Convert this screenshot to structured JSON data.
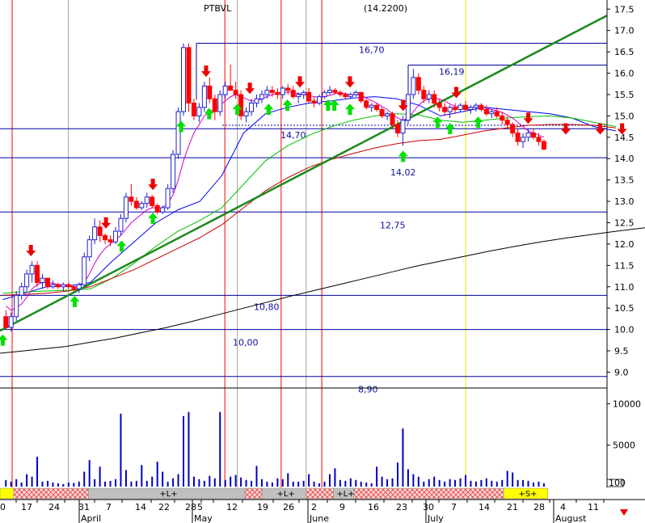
{
  "chart_data": {
    "type": "candlestick",
    "title": "PTBVL",
    "header_values": "(14.2200)",
    "colors": {
      "up": "#2020d0",
      "down": "#ff0000",
      "ma_fast": "#cc00cc",
      "ma_blue": "#0000ff",
      "ma_green": "#00c000",
      "ma_red": "#cc0000",
      "ma_long": "#000000",
      "trendline": "#1a8a1a",
      "level_line": "#0000a0",
      "volume": "#0000c0",
      "buy_arrow": "#00e000",
      "sell_arrow": "#ee0000",
      "vline_red": "#ff0000",
      "vline_gray": "#a0a0a0",
      "vline_yellow": "#e8e800"
    },
    "y_axis": {
      "range": [
        8.8,
        17.6
      ],
      "ticks": [
        "17.5",
        "17.0",
        "16.5",
        "16.0",
        "15.5",
        "15.0",
        "14.5",
        "14.0",
        "13.5",
        "13.0",
        "12.5",
        "12.0",
        "11.5",
        "11.0",
        "10.5",
        "10.0",
        "9.5",
        "9.0"
      ]
    },
    "volume_axis": {
      "range": [
        0,
        11500
      ],
      "ticks": [
        "10000",
        "5000"
      ],
      "footer": "100"
    },
    "x_axis": {
      "day_labels": [
        "0",
        "17",
        "24",
        "31",
        "7",
        "14",
        "22",
        "28",
        "5",
        "12",
        "19",
        "26",
        "2",
        "9",
        "16",
        "23",
        "30",
        "7",
        "14",
        "21",
        "28",
        "4",
        "11"
      ],
      "month_labels": [
        "April",
        "May",
        "June",
        "July",
        "August"
      ]
    },
    "levels": [
      {
        "value": 16.7,
        "label": "16,70"
      },
      {
        "value": 16.19,
        "label": "16,19"
      },
      {
        "value": 14.7,
        "label": "14,70"
      },
      {
        "value": 14.02,
        "label": "14,02"
      },
      {
        "value": 12.75,
        "label": "12,75"
      },
      {
        "value": 10.8,
        "label": "10,80"
      },
      {
        "value": 10.0,
        "label": "10,00"
      },
      {
        "value": 8.9,
        "label": "8,90"
      }
    ],
    "dotted_level": 14.78,
    "trendline": {
      "start": [
        0,
        9.97
      ],
      "end": [
        141,
        17.35
      ]
    },
    "candles": [
      [
        10.3,
        10.45,
        10.0,
        10.05
      ],
      [
        10.05,
        10.4,
        9.95,
        10.3
      ],
      [
        10.3,
        10.9,
        10.2,
        10.8
      ],
      [
        10.8,
        11.1,
        10.7,
        11.0
      ],
      [
        11.0,
        11.4,
        10.9,
        11.3
      ],
      [
        11.3,
        11.6,
        11.1,
        11.5
      ],
      [
        11.5,
        11.6,
        11.0,
        11.1
      ],
      [
        11.1,
        11.3,
        10.95,
        11.2
      ],
      [
        11.2,
        11.2,
        10.95,
        11.0
      ],
      [
        11.0,
        11.15,
        10.95,
        11.05
      ],
      [
        11.05,
        11.1,
        10.95,
        11.0
      ],
      [
        11.0,
        11.1,
        10.9,
        11.05
      ],
      [
        11.05,
        11.1,
        10.95,
        11.0
      ],
      [
        11.0,
        11.05,
        10.9,
        10.95
      ],
      [
        10.95,
        11.1,
        10.85,
        11.05
      ],
      [
        11.05,
        11.8,
        11.0,
        11.7
      ],
      [
        11.7,
        12.2,
        11.6,
        12.1
      ],
      [
        12.1,
        12.6,
        12.0,
        12.4
      ],
      [
        12.4,
        12.55,
        12.05,
        12.2
      ],
      [
        12.2,
        12.25,
        12.0,
        12.1
      ],
      [
        12.1,
        12.2,
        11.95,
        12.05
      ],
      [
        12.05,
        12.4,
        12.0,
        12.3
      ],
      [
        12.3,
        12.7,
        12.2,
        12.6
      ],
      [
        12.6,
        13.2,
        12.5,
        13.1
      ],
      [
        13.1,
        13.4,
        12.9,
        13.0
      ],
      [
        13.0,
        13.1,
        12.8,
        12.85
      ],
      [
        12.85,
        13.0,
        12.8,
        12.95
      ],
      [
        12.95,
        13.2,
        12.85,
        13.1
      ],
      [
        13.1,
        13.15,
        12.85,
        12.9
      ],
      [
        12.9,
        12.95,
        12.7,
        12.75
      ],
      [
        12.75,
        12.9,
        12.7,
        12.85
      ],
      [
        12.85,
        13.4,
        12.8,
        13.3
      ],
      [
        13.3,
        14.2,
        13.2,
        14.1
      ],
      [
        14.1,
        15.2,
        14.0,
        15.1
      ],
      [
        15.1,
        16.7,
        15.0,
        16.6
      ],
      [
        16.6,
        16.7,
        15.1,
        15.3
      ],
      [
        15.3,
        15.4,
        14.9,
        15.0
      ],
      [
        15.0,
        15.3,
        14.85,
        15.2
      ],
      [
        15.2,
        15.8,
        15.1,
        15.7
      ],
      [
        15.7,
        15.9,
        15.3,
        15.4
      ],
      [
        15.4,
        15.5,
        14.9,
        15.1
      ],
      [
        15.1,
        15.6,
        15.0,
        15.5
      ],
      [
        15.5,
        15.8,
        15.4,
        15.7
      ],
      [
        15.7,
        16.2,
        15.6,
        15.6
      ],
      [
        15.6,
        15.8,
        15.4,
        15.5
      ],
      [
        15.5,
        15.6,
        14.9,
        15.0
      ],
      [
        15.0,
        15.2,
        14.85,
        15.1
      ],
      [
        15.1,
        15.4,
        15.0,
        15.3
      ],
      [
        15.3,
        15.5,
        15.2,
        15.4
      ],
      [
        15.4,
        15.6,
        15.3,
        15.5
      ],
      [
        15.5,
        15.7,
        15.4,
        15.6
      ],
      [
        15.6,
        15.7,
        15.45,
        15.55
      ],
      [
        15.55,
        15.65,
        15.4,
        15.5
      ],
      [
        15.5,
        15.7,
        15.4,
        15.65
      ],
      [
        15.65,
        15.75,
        15.5,
        15.6
      ],
      [
        15.6,
        15.7,
        15.4,
        15.45
      ],
      [
        15.45,
        15.55,
        15.3,
        15.5
      ],
      [
        15.5,
        15.6,
        15.4,
        15.55
      ],
      [
        15.55,
        15.65,
        15.3,
        15.35
      ],
      [
        15.35,
        15.45,
        15.2,
        15.3
      ],
      [
        15.3,
        15.5,
        15.25,
        15.45
      ],
      [
        15.45,
        15.6,
        15.4,
        15.55
      ],
      [
        15.55,
        15.7,
        15.5,
        15.6
      ],
      [
        15.6,
        15.65,
        15.5,
        15.55
      ],
      [
        15.55,
        15.6,
        15.45,
        15.5
      ],
      [
        15.5,
        15.55,
        15.4,
        15.45
      ],
      [
        15.45,
        15.55,
        15.4,
        15.5
      ],
      [
        15.5,
        15.6,
        15.45,
        15.55
      ],
      [
        15.55,
        15.55,
        15.3,
        15.35
      ],
      [
        15.35,
        15.4,
        15.15,
        15.2
      ],
      [
        15.2,
        15.3,
        15.1,
        15.25
      ],
      [
        15.25,
        15.3,
        15.1,
        15.15
      ],
      [
        15.15,
        15.2,
        14.95,
        15.0
      ],
      [
        15.0,
        15.1,
        14.9,
        15.05
      ],
      [
        15.05,
        15.1,
        14.7,
        14.8
      ],
      [
        14.8,
        14.9,
        14.5,
        14.6
      ],
      [
        14.6,
        15.0,
        14.3,
        14.9
      ],
      [
        14.9,
        15.6,
        14.8,
        15.5
      ],
      [
        15.5,
        16.1,
        15.4,
        15.9
      ],
      [
        15.9,
        16.0,
        15.5,
        15.6
      ],
      [
        15.6,
        15.7,
        15.3,
        15.4
      ],
      [
        15.4,
        15.6,
        15.3,
        15.5
      ],
      [
        15.5,
        15.6,
        15.2,
        15.3
      ],
      [
        15.3,
        15.4,
        15.1,
        15.2
      ],
      [
        15.2,
        15.3,
        15.0,
        15.1
      ],
      [
        15.1,
        15.25,
        14.95,
        15.2
      ],
      [
        15.2,
        15.3,
        15.05,
        15.15
      ],
      [
        15.15,
        15.3,
        15.1,
        15.25
      ],
      [
        15.25,
        15.35,
        15.1,
        15.15
      ],
      [
        15.15,
        15.25,
        15.05,
        15.2
      ],
      [
        15.2,
        15.3,
        15.1,
        15.25
      ],
      [
        15.25,
        15.3,
        15.1,
        15.15
      ],
      [
        15.15,
        15.25,
        15.0,
        15.05
      ],
      [
        15.05,
        15.15,
        14.95,
        15.1
      ],
      [
        15.1,
        15.2,
        14.95,
        15.0
      ],
      [
        15.0,
        15.1,
        14.8,
        14.9
      ],
      [
        14.9,
        15.0,
        14.7,
        14.8
      ],
      [
        14.8,
        14.85,
        14.5,
        14.6
      ],
      [
        14.6,
        14.7,
        14.3,
        14.4
      ],
      [
        14.4,
        14.6,
        14.25,
        14.5
      ],
      [
        14.5,
        14.7,
        14.4,
        14.6
      ],
      [
        14.6,
        14.7,
        14.45,
        14.5
      ],
      [
        14.5,
        14.6,
        14.3,
        14.4
      ],
      [
        14.4,
        14.45,
        14.2,
        14.22
      ]
    ],
    "moving_averages_fast": [
      10.55,
      10.45,
      10.5,
      10.6,
      10.75,
      10.95,
      11.05,
      11.1,
      11.1,
      11.08,
      11.05,
      11.05,
      11.03,
      11.0,
      11.0,
      11.1,
      11.3,
      11.55,
      11.75,
      11.9,
      12.0,
      12.1,
      12.2,
      12.35,
      12.5,
      12.6,
      12.7,
      12.8,
      12.85,
      12.85,
      12.85,
      12.95,
      13.15,
      13.5,
      13.95,
      14.3,
      14.6,
      14.8,
      15.0,
      15.1,
      15.15,
      15.25,
      15.35,
      15.45,
      15.5,
      15.45,
      15.4,
      15.35,
      15.35,
      15.4,
      15.45,
      15.5,
      15.52,
      15.55,
      15.56,
      15.55,
      15.52,
      15.5,
      15.48,
      15.45,
      15.44,
      15.45,
      15.48,
      15.52,
      15.53,
      15.52,
      15.5,
      15.5,
      15.48,
      15.42,
      15.36,
      15.3,
      15.22,
      15.15,
      15.05,
      14.95,
      14.9,
      14.95,
      15.1,
      15.25,
      15.35,
      15.4,
      15.42,
      15.4,
      15.35,
      15.28,
      15.22,
      15.2,
      15.2,
      15.2,
      15.2,
      15.2,
      15.18,
      15.15,
      15.12,
      15.08,
      15.02,
      14.95,
      14.85,
      14.75,
      14.65,
      14.6,
      14.55,
      14.5
    ],
    "series": [
      {
        "name": "",
        "style": "ma_blue",
        "start": 0,
        "step": 7,
        "values": [
          10.7,
          10.85,
          11.0,
          11.02,
          11.1,
          11.6,
          12.05,
          12.5,
          12.8,
          13.0,
          13.6,
          14.6,
          15.05,
          15.2,
          15.3,
          15.35,
          15.42,
          15.45,
          15.4,
          15.25,
          15.0,
          15.1,
          15.2,
          15.15,
          15.1,
          15.05,
          14.95,
          14.75,
          14.65
        ]
      },
      {
        "name": "",
        "style": "ma_green",
        "start": 0,
        "step": 7,
        "values": [
          10.85,
          10.88,
          10.9,
          10.92,
          10.95,
          11.2,
          11.55,
          11.95,
          12.3,
          12.55,
          12.85,
          13.4,
          13.95,
          14.3,
          14.55,
          14.75,
          14.9,
          15.0,
          15.05,
          15.02,
          14.9,
          14.85,
          14.9,
          14.95,
          14.98,
          15.0,
          14.95,
          14.85,
          14.75
        ]
      },
      {
        "name": "",
        "style": "ma_red",
        "start": 0,
        "step": 7,
        "values": [
          10.8,
          10.82,
          10.85,
          10.9,
          11.0,
          11.2,
          11.4,
          11.65,
          11.9,
          12.15,
          12.45,
          12.85,
          13.25,
          13.55,
          13.8,
          13.98,
          14.12,
          14.25,
          14.35,
          14.42,
          14.45,
          14.55,
          14.65,
          14.72,
          14.78,
          14.8,
          14.8,
          14.78,
          14.72
        ]
      },
      {
        "name": "",
        "style": "ma_long",
        "start": -28,
        "step": 8,
        "values": [
          9.25,
          9.3,
          9.36,
          9.42,
          9.48,
          9.54,
          9.6,
          9.7,
          9.8,
          9.92,
          10.04,
          10.18,
          10.33,
          10.48,
          10.63,
          10.78,
          10.92,
          11.06,
          11.2,
          11.34,
          11.48,
          11.6,
          11.72,
          11.84,
          11.95,
          12.05,
          12.14,
          12.22,
          12.3,
          12.37,
          12.44
        ]
      }
    ],
    "volume": [
      800,
      600,
      900,
      500,
      1500,
      1200,
      3600,
      600,
      700,
      500,
      400,
      300,
      500,
      450,
      600,
      1800,
      3200,
      900,
      2400,
      600,
      700,
      900,
      8800,
      2000,
      600,
      700,
      2600,
      700,
      1200,
      3000,
      1800,
      600,
      1000,
      1500,
      8500,
      9000,
      1200,
      900,
      700,
      1300,
      1000,
      9000,
      800,
      1200,
      1400,
      1100,
      800,
      700,
      2500,
      900,
      600,
      500,
      1000,
      900,
      1600,
      600,
      600,
      700,
      1500,
      600,
      400,
      600,
      1500,
      2200,
      800,
      700,
      1000,
      800,
      600,
      500,
      400,
      2400,
      1200,
      900,
      1000,
      2900,
      7000,
      2100,
      1500,
      1200,
      600,
      900,
      1200,
      800,
      600,
      900,
      800,
      1000,
      1400,
      700,
      600,
      800,
      1000,
      700,
      600,
      800,
      1900,
      1700,
      800,
      800,
      700,
      500,
      600,
      400
    ],
    "buy_signal_indices": [
      0,
      23,
      38,
      48,
      57,
      66,
      75,
      85,
      91,
      104,
      106,
      111,
      128,
      139,
      143,
      152
    ],
    "sell_signal_indices": [
      9,
      33,
      48,
      65,
      79,
      95,
      111,
      128,
      145,
      168,
      180,
      191,
      198
    ],
    "vertical_lines": [
      {
        "x_index": 3,
        "style": "vline_red"
      },
      {
        "x_index": 21,
        "style": "vline_gray"
      },
      {
        "x_index": 71,
        "style": "vline_red"
      },
      {
        "x_index": 75,
        "style": "vline_gray"
      },
      {
        "x_index": 89,
        "style": "vline_red"
      },
      {
        "x_index": 97,
        "style": "vline_gray"
      },
      {
        "x_index": 102,
        "style": "vline_red"
      },
      {
        "x_index": 148,
        "style": "vline_yellow"
      }
    ],
    "status_bar": [
      {
        "from": 0,
        "to": 4,
        "fill": "#ffff00",
        "label": ""
      },
      {
        "from": 4,
        "to": 26,
        "fill": "hatch",
        "label": ""
      },
      {
        "from": 26,
        "to": 72,
        "fill": "#c0c0c0",
        "label": "+L+"
      },
      {
        "from": 72,
        "to": 77,
        "fill": "hatch",
        "label": ""
      },
      {
        "from": 77,
        "to": 90,
        "fill": "#c0c0c0",
        "label": "+L+"
      },
      {
        "from": 90,
        "to": 98,
        "fill": "hatch",
        "label": ""
      },
      {
        "from": 98,
        "to": 104,
        "fill": "#c0c0c0",
        "label": "+L+"
      },
      {
        "from": 104,
        "to": 148,
        "fill": "hatch",
        "label": ""
      },
      {
        "from": 148,
        "to": 161,
        "fill": "#ffff00",
        "label": "+S+"
      }
    ]
  }
}
